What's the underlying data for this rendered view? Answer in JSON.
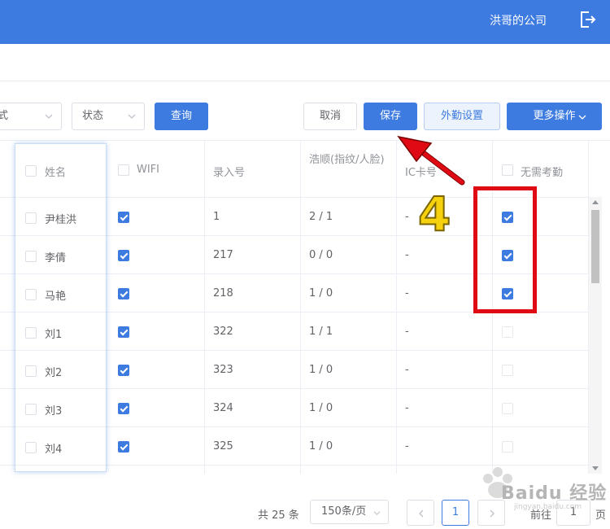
{
  "header": {
    "company": "洪哥的公司"
  },
  "filters": {
    "select_prev_fragment": "式",
    "status_select": "状态",
    "query_button": "查询",
    "cancel_button": "取消",
    "save_button": "保存",
    "field_settings_button": "外勤设置",
    "more_actions_button": "更多操作"
  },
  "table": {
    "headers": {
      "name": "姓名",
      "wifi": "WIFI",
      "record_no": "录入号",
      "haoshun": "浩顺(指纹/人脸)",
      "ic_card": "IC卡号",
      "no_attendance": "无需考勤"
    },
    "rows": [
      {
        "name": "尹桂洪",
        "wifi": true,
        "record_no": "1",
        "haoshun": "2 / 1",
        "ic_card": "-",
        "no_attendance": true
      },
      {
        "name": "李倩",
        "wifi": true,
        "record_no": "217",
        "haoshun": "0 / 0",
        "ic_card": "-",
        "no_attendance": true
      },
      {
        "name": "马艳",
        "wifi": true,
        "record_no": "218",
        "haoshun": "1 / 0",
        "ic_card": "-",
        "no_attendance": true
      },
      {
        "name": "刘1",
        "wifi": true,
        "record_no": "322",
        "haoshun": "1 / 1",
        "ic_card": "-",
        "no_attendance": false
      },
      {
        "name": "刘2",
        "wifi": true,
        "record_no": "323",
        "haoshun": "1 / 0",
        "ic_card": "-",
        "no_attendance": false
      },
      {
        "name": "刘3",
        "wifi": true,
        "record_no": "324",
        "haoshun": "1 / 0",
        "ic_card": "-",
        "no_attendance": false
      },
      {
        "name": "刘4",
        "wifi": true,
        "record_no": "325",
        "haoshun": "1 / 0",
        "ic_card": "-",
        "no_attendance": false
      }
    ]
  },
  "annotation": {
    "step_number": "4"
  },
  "pagination": {
    "total_text": "共 25 条",
    "page_size": "150条/页",
    "current_page": "1",
    "goto_label": "前往",
    "goto_value": "1",
    "page_suffix": "页"
  },
  "watermark": {
    "brand": "Baidu 经验",
    "url": "jingyan.baidu.com"
  },
  "colors": {
    "primary": "#3d7be0",
    "annotation_red": "#e00a14",
    "annotation_yellow": "#f6d20e"
  }
}
